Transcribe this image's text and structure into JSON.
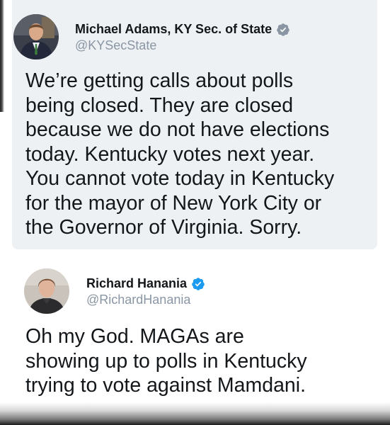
{
  "quoted_tweet": {
    "display_name": "Michael Adams, KY Sec. of State",
    "handle": "@KYSecState",
    "verified": true,
    "lines": [
      "We’re getting calls about polls",
      "being closed. They are closed",
      "because we do not have elections",
      "today. Kentucky votes next year.",
      "You cannot vote today in Kentucky",
      "for the mayor of New York City or",
      "the Governor of Virginia. Sorry."
    ]
  },
  "reply_tweet": {
    "display_name": "Richard Hanania",
    "handle": "@RichardHanania",
    "verified": true,
    "lines": [
      "Oh my God. MAGAs are",
      "showing up to polls in Kentucky",
      "trying to vote against Mamdani."
    ]
  },
  "colors": {
    "text": "#14171a",
    "handle": "#8a96a3",
    "verified": "#1d9bf0",
    "quoted_card_bg": "#eef1f4"
  },
  "icons": {
    "verified_badge": "verified-badge-icon"
  }
}
